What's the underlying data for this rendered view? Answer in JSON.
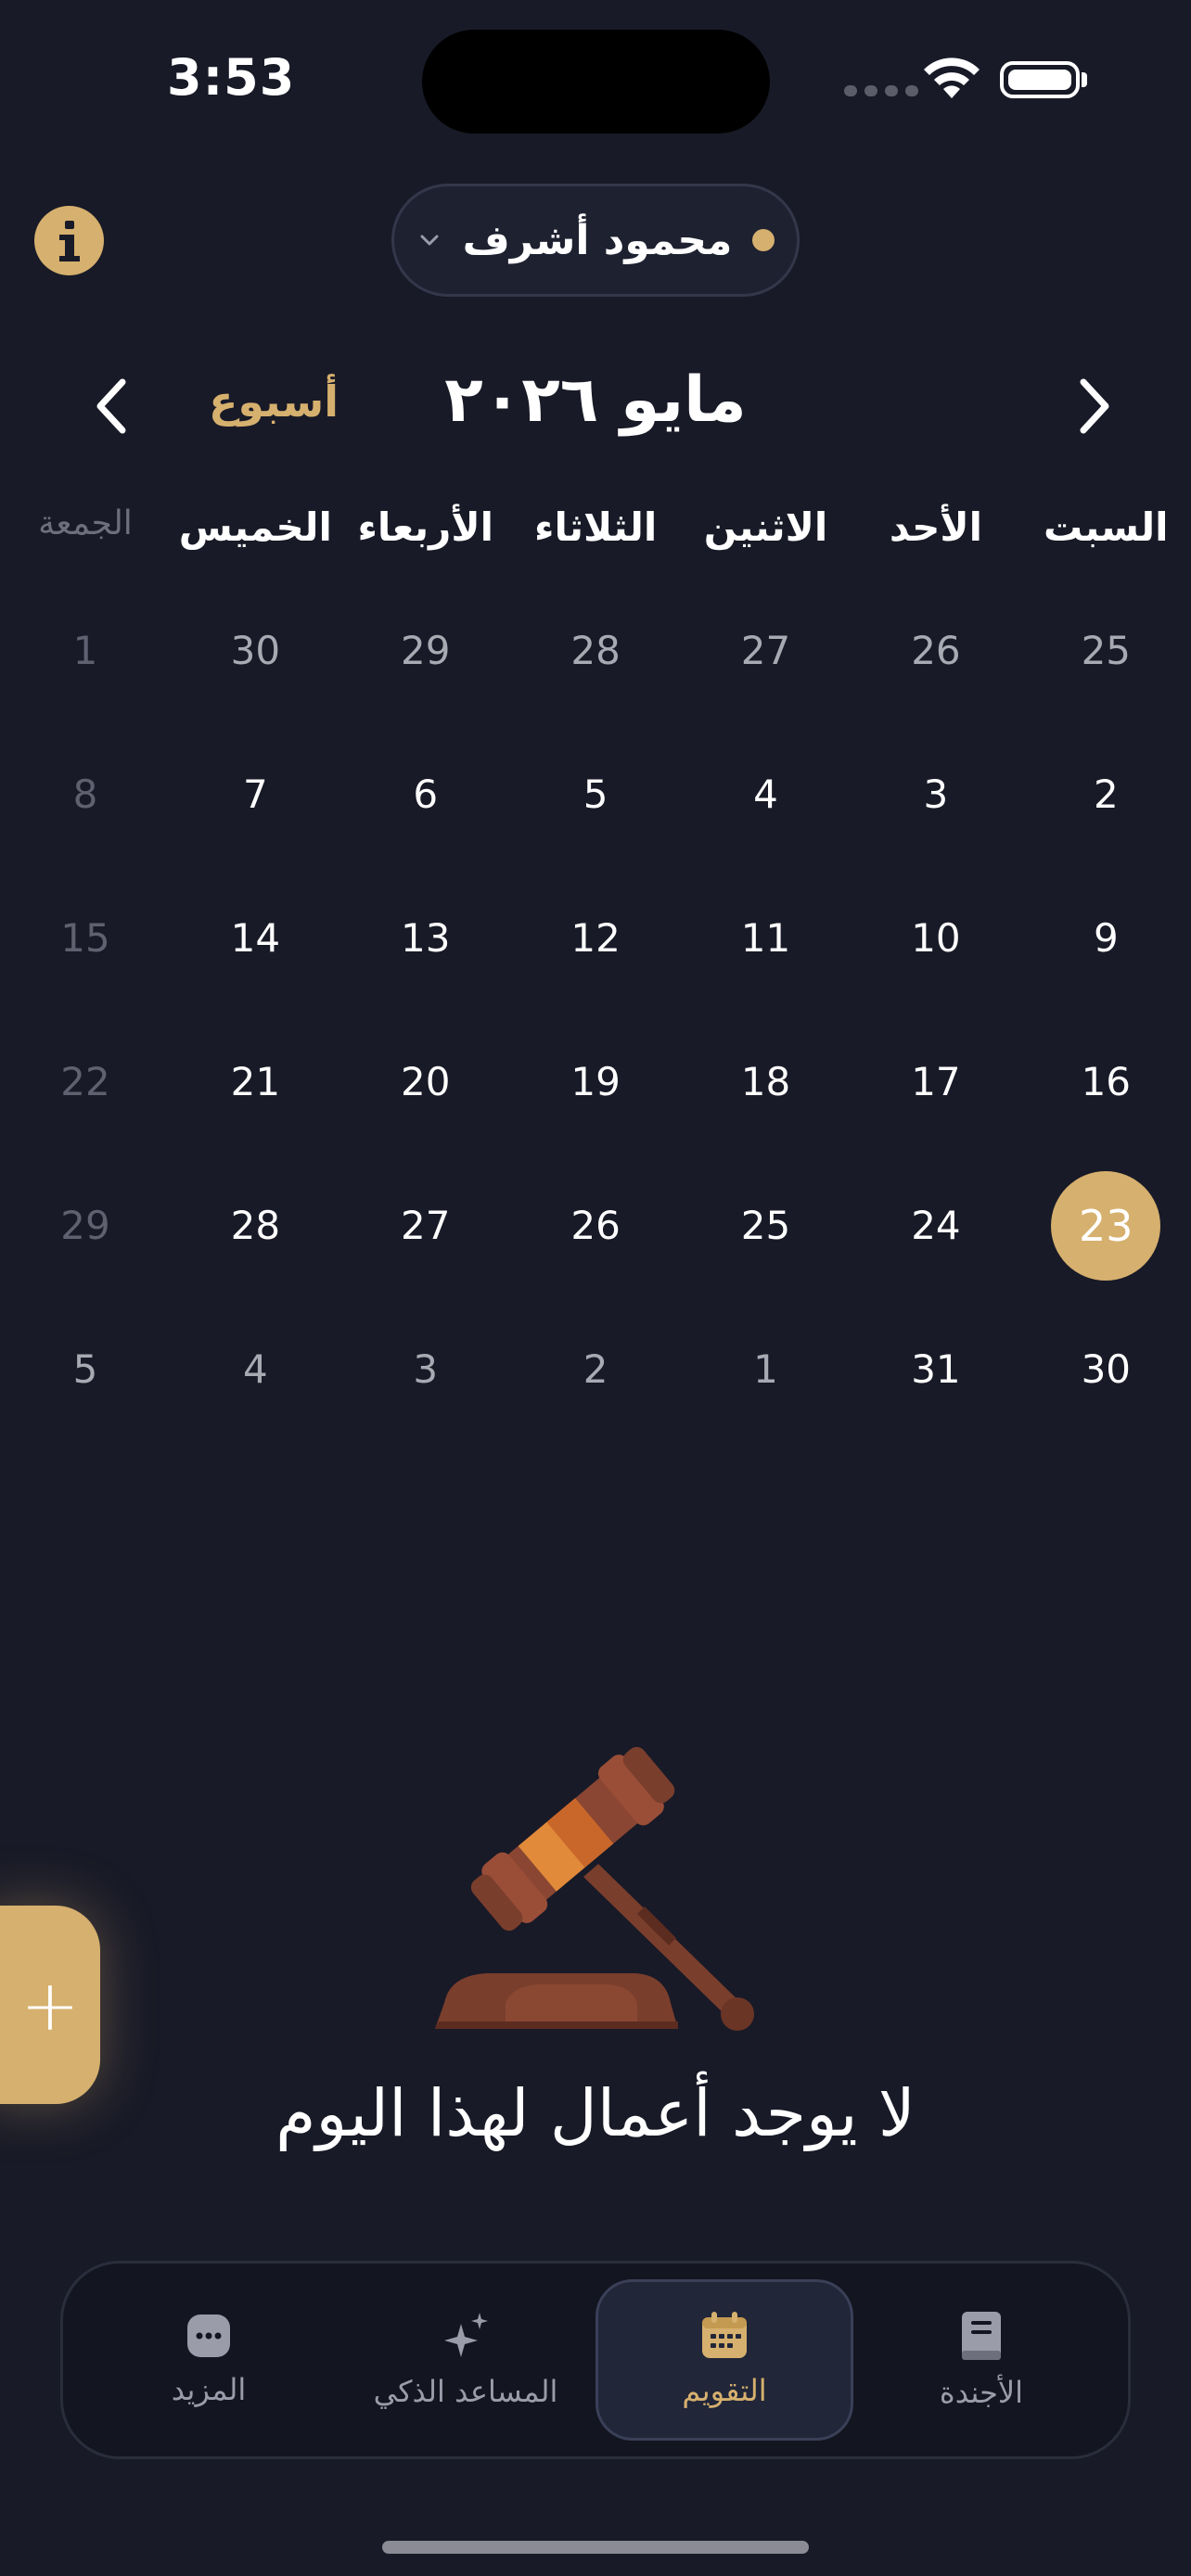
{
  "status_bar": {
    "time": "3:53"
  },
  "header": {
    "user_name": "محمود أشرف"
  },
  "calendar": {
    "view_toggle": "أسبوع",
    "month_title": "مايو ٢٠٢٦",
    "weekdays": [
      "السبت",
      "الأحد",
      "الاثنين",
      "الثلاثاء",
      "الأربعاء",
      "الخميس",
      "الجمعة"
    ],
    "weeks": [
      [
        "25",
        "26",
        "27",
        "28",
        "29",
        "30",
        "1"
      ],
      [
        "2",
        "3",
        "4",
        "5",
        "6",
        "7",
        "8"
      ],
      [
        "9",
        "10",
        "11",
        "12",
        "13",
        "14",
        "15"
      ],
      [
        "16",
        "17",
        "18",
        "19",
        "20",
        "21",
        "22"
      ],
      [
        "23",
        "24",
        "25",
        "26",
        "27",
        "28",
        "29"
      ],
      [
        "30",
        "31",
        "1",
        "2",
        "3",
        "4",
        "5"
      ]
    ],
    "selected_day": "23"
  },
  "empty_state": {
    "message": "لا يوجد أعمال لهذا اليوم",
    "icon": "gavel-icon"
  },
  "fab": {
    "label": "+"
  },
  "tabbar": {
    "tabs": [
      {
        "label": "الأجندة",
        "icon": "book-icon",
        "active": false
      },
      {
        "label": "التقويم",
        "icon": "calendar-icon",
        "active": true
      },
      {
        "label": "المساعد الذكي",
        "icon": "sparkles-icon",
        "active": false
      },
      {
        "label": "المزيد",
        "icon": "more-icon",
        "active": false
      }
    ]
  },
  "colors": {
    "background": "#181a27",
    "accent": "#d6b06e",
    "muted": "#6d6f7c"
  }
}
